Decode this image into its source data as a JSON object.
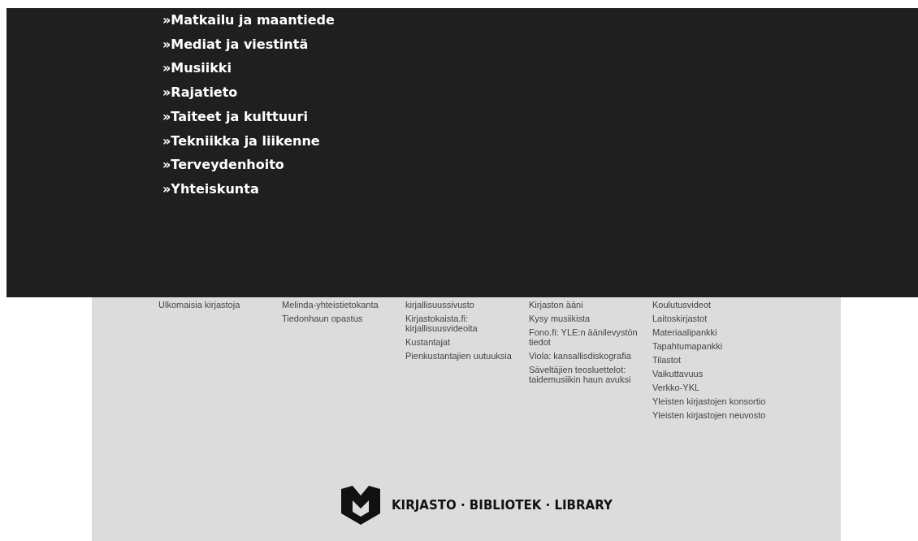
{
  "menu": {
    "items": [
      "»Matkailu ja maantiede",
      "»Mediat ja viestintä",
      "»Musiikki",
      "»Rajatieto",
      "»Taiteet ja kulttuuri",
      "»Tekniikka ja liikenne",
      "»Terveydenhoito",
      "»Yhteiskunta"
    ]
  },
  "footer": {
    "columns": [
      {
        "links": [
          "Ulkomaisia kirjastoja"
        ]
      },
      {
        "links": [
          "Melinda-yhteistietokanta",
          "Tiedonhaun opastus"
        ]
      },
      {
        "links": [
          "kirjallisuussivusto",
          "Kirjastokaista.fi: kirjallisuusvideoita",
          "Kustantajat",
          "Pienkustantajien uutuuksia"
        ]
      },
      {
        "links": [
          "Kirjaston ääni",
          "Kysy musiikista",
          "Fono.fi: YLE:n äänilevystön tiedot",
          "Viola: kansallisdiskografia",
          "Säveltäjien teosluettelot: taidemusiikin haun avuksi"
        ]
      },
      {
        "links": [
          "Koulutusvideot",
          "Laitoskirjastot",
          "Materiaalipankki",
          "Tapahtumapankki",
          "Tilastot",
          "Vaikuttavuus",
          "Verkko-YKL",
          "Yleisten kirjastojen konsortio",
          "Yleisten kirjastojen neuvosto"
        ]
      }
    ],
    "brand": "KIRJASTO · BIBLIOTEK · LIBRARY"
  }
}
